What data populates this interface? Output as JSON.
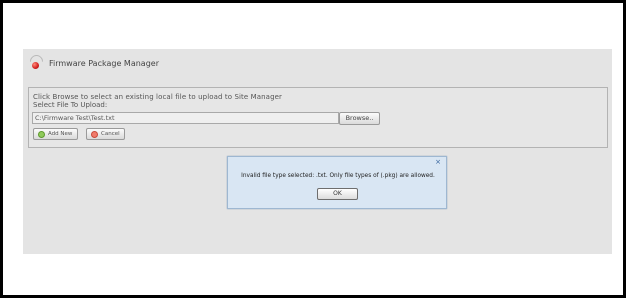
{
  "header": {
    "title": "Firmware Package Manager",
    "icon": "app-status-icon"
  },
  "upload": {
    "instruction": "Click Browse to select an existing local file to upload to Site Manager",
    "file_label": "Select File To Upload:",
    "file_path": "C:\\Firmware Test\\Test.txt",
    "browse_label": "Browse..",
    "add_label": "Add New",
    "cancel_label": "Cancel"
  },
  "dialog": {
    "close_symbol": "×",
    "message": "Invalid file type selected: .txt. Only file types of (.pkg) are allowed.",
    "ok_label": "OK"
  },
  "colors": {
    "panel_bg": "#e4e4e4",
    "dialog_bg": "#d9e6f3",
    "dialog_border": "#9eb7d1",
    "add_icon": "#8fca5a",
    "cancel_icon": "#f07a6a"
  }
}
